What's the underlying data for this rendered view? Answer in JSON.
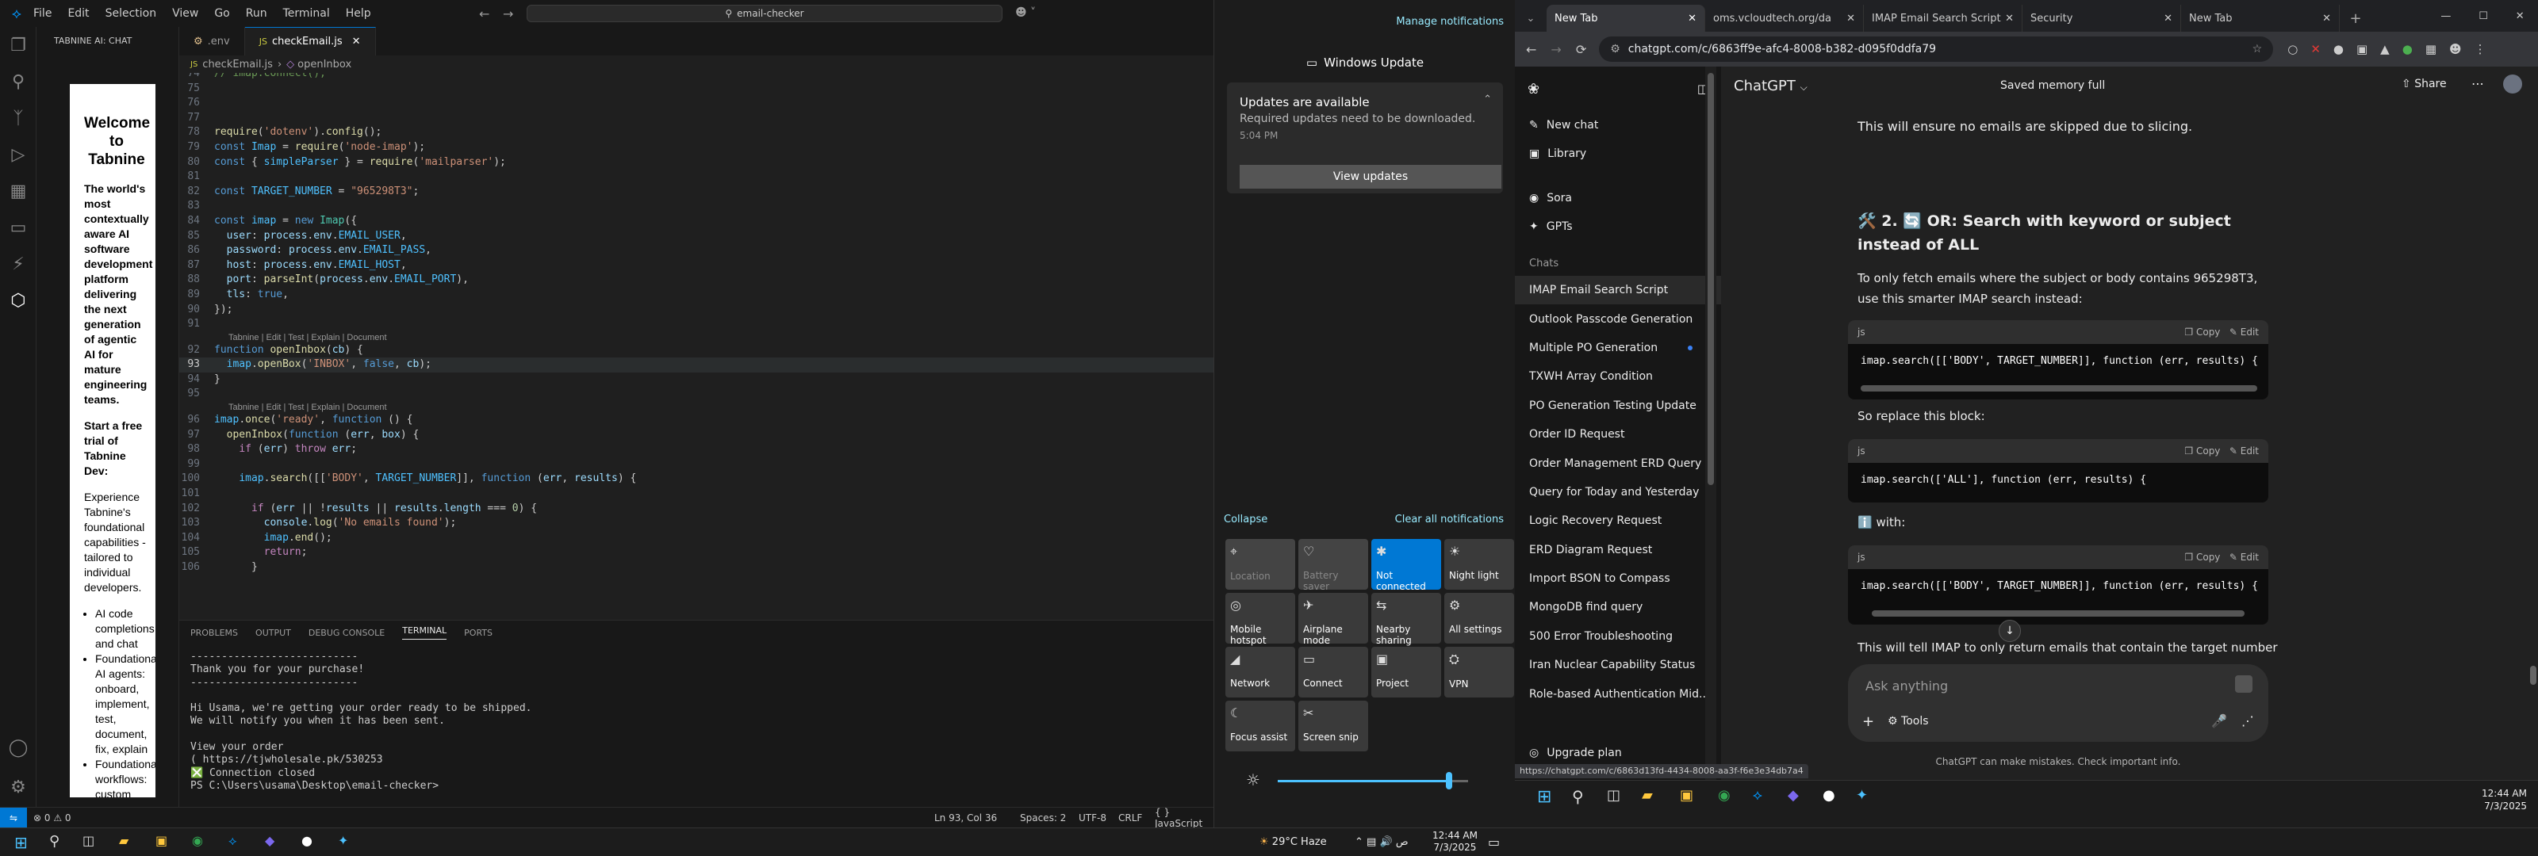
{
  "vscode": {
    "menu": [
      "File",
      "Edit",
      "Selection",
      "View",
      "Go",
      "Run",
      "Terminal",
      "Help"
    ],
    "search_text": "email-checker",
    "sidebar_title": "TABNINE AI: CHAT",
    "tabnine": {
      "heading": "Welcome to Tabnine",
      "p1": "The world's most contextually aware AI software development platform delivering the next generation of agentic AI for mature engineering teams.",
      "p2": "Start a free trial of Tabnine Dev:",
      "p3": "Experience Tabnine's foundational capabilities - tailored to individual developers.",
      "bullets": [
        "AI code completions and chat",
        "Foundational AI agents: onboard, implement, test, document, fix, explain",
        "Foundational workflows: custom commands, custom chat"
      ]
    },
    "tabs": [
      {
        "label": ".env"
      },
      {
        "label": "checkEmail.js"
      }
    ],
    "breadcrumb": [
      "checkEmail.js",
      "openInbox"
    ],
    "lens_label": "Tabnine | Edit | Test | Explain | Document",
    "panel_tabs": [
      "PROBLEMS",
      "OUTPUT",
      "DEBUG CONSOLE",
      "TERMINAL",
      "PORTS"
    ],
    "terminal": "---------------------------\nThank you for your purchase!\n---------------------------\n\nHi Usama, we're getting your order ready to be shipped.\nWe will notify you when it has been sent.\n\nView your order\n( https://tjwholesale.pk/530253\n❎ Connection closed\nPS C:\\Users\\usama\\Desktop\\email-checker> ",
    "status": {
      "errors": "⊗ 0 ⚠ 0",
      "position": "Ln 93, Col 36",
      "spaces": "Spaces: 2",
      "encoding": "UTF-8",
      "eol": "CRLF",
      "lang": "{ } JavaScript"
    }
  },
  "notifications": {
    "manage": "Manage notifications",
    "group": "Windows Update",
    "title": "Updates are available",
    "body": "Required updates need to be downloaded.",
    "time": "5:04 PM",
    "button": "View updates",
    "collapse": "Collapse",
    "clear": "Clear all notifications",
    "tiles": [
      {
        "label": "Location",
        "icon": "⌖",
        "state": "dim"
      },
      {
        "label": "Battery saver",
        "icon": "♡",
        "state": "dim"
      },
      {
        "label": "Not connected",
        "icon": "✱",
        "state": "on"
      },
      {
        "label": "Night light",
        "icon": "☀",
        "state": "off"
      },
      {
        "label": "Mobile hotspot",
        "icon": "◎",
        "state": "off"
      },
      {
        "label": "Airplane mode",
        "icon": "✈",
        "state": "off"
      },
      {
        "label": "Nearby sharing",
        "icon": "⇆",
        "state": "off"
      },
      {
        "label": "All settings",
        "icon": "⚙",
        "state": "off"
      },
      {
        "label": "Network",
        "icon": "◢",
        "state": "off"
      },
      {
        "label": "Connect",
        "icon": "▭",
        "state": "off"
      },
      {
        "label": "Project",
        "icon": "▣",
        "state": "off"
      },
      {
        "label": "VPN",
        "icon": "⛭",
        "state": "off"
      },
      {
        "label": "Focus assist",
        "icon": "☾",
        "state": "off"
      },
      {
        "label": "Screen snip",
        "icon": "✂",
        "state": "off"
      }
    ],
    "brightness": 0.9
  },
  "browser": {
    "tabs": [
      "New Tab",
      "oms.vcloudtech.org/da",
      "IMAP Email Search Script",
      "Security",
      "New Tab"
    ],
    "url": "chatgpt.com/c/6863ff9e-afc4-8008-b382-d095f0ddfa79",
    "hover_link": "https://chatgpt.com/c/6863d13fd-4434-8008-aa3f-f6e3e34db7a4"
  },
  "chatgpt": {
    "model": "ChatGPT",
    "memory": "Saved memory full",
    "share": "Share",
    "nav": [
      "New chat",
      "Library",
      "Sora",
      "GPTs"
    ],
    "chats_heading": "Chats",
    "chats": [
      "IMAP Email Search Script",
      "Outlook Passcode Generation",
      "Multiple PO Generation",
      "TXWH Array Condition",
      "PO Generation Testing Update",
      "Order ID Request",
      "Order Management ERD Query",
      "Query for Today and Yesterday",
      "Logic Recovery Request",
      "ERD Diagram Request",
      "Import BSON to Compass",
      "MongoDB find query",
      "500 Error Troubleshooting",
      "Iran Nuclear Capability Status",
      "Role-based Authentication Mid..."
    ],
    "upgrade": "Upgrade plan",
    "line1": "This will ensure no emails are skipped due to slicing.",
    "heading": "🛠️ 2. 🔄 OR: Search with keyword or subject instead of ALL",
    "para1": "To only fetch emails where the subject or body contains 965298T3, use this smarter IMAP search instead:",
    "code_lang": "js",
    "copy": "Copy",
    "edit": "Edit",
    "code1": "imap.search([['BODY', TARGET_NUMBER]], function (err, results) {",
    "so_replace": "So replace this block:",
    "code2": "imap.search(['ALL'], function (err, results) {",
    "with": "ℹ️ with:",
    "code3": "imap.search([['BODY', TARGET_NUMBER]], function (err, results) {",
    "para2": "This will tell IMAP to only return emails that contain the target number",
    "ask": "Ask anything",
    "tools": "Tools",
    "disclaimer": "ChatGPT can make mistakes. Check important info."
  },
  "taskbar": {
    "weather": "29°C Haze",
    "time_left": "12:44 AM",
    "date_left": "7/3/2025",
    "time_right": "12:44 AM",
    "date_right": "7/3/2025"
  }
}
